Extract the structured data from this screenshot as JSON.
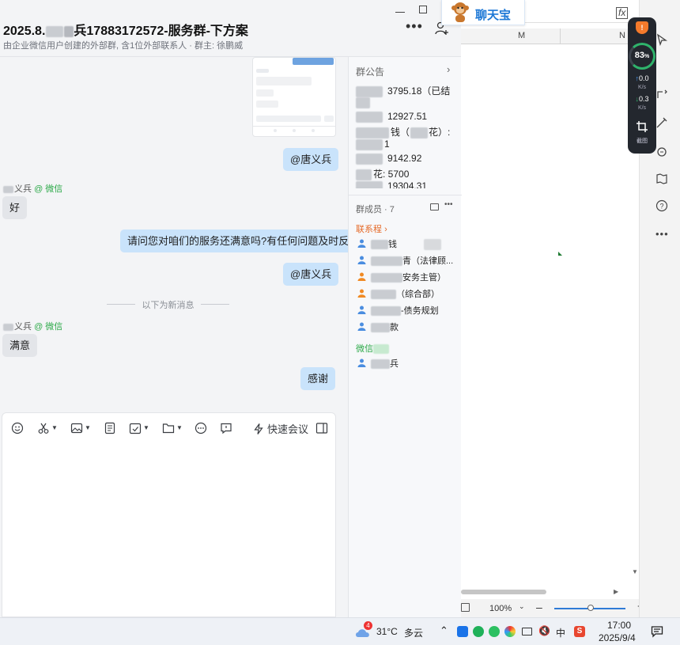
{
  "chat": {
    "title": "2025.8.2███义兵17883172572-服务群-下方案",
    "title_visible": "2025.8.",
    "title_tail": "兵17883172572-服务群-下方案",
    "subtitle": "由企业微信用户创建的外部群, 含1位外部联系人 · 群主: 徐鹏威",
    "more_label": "•••"
  },
  "messages": {
    "mention1": "@唐义兵",
    "sender1": "义兵",
    "sender1_source": "@ 微信",
    "reply1": "好",
    "question": "请问您对咱们的服务还满意吗?有任何问题及时反馈",
    "mention2": "@唐义兵",
    "new_divider": "以下为新消息",
    "sender2": "义兵",
    "sender2_source": "@ 微信",
    "reply2": "满意",
    "thanks": "感谢"
  },
  "composer": {
    "quick_meeting": "快速会议"
  },
  "sidebar": {
    "notice_title": "群公告",
    "notice_lines": [
      "3795.18（已结",
      "12927.51",
      "钱（",
      "花）:",
      "1",
      "9142.92",
      "花: ",
      "5700",
      "19304.31"
    ],
    "members_title": "群成员 · 7",
    "role_label": "联系程",
    "members": [
      {
        "name": "钱",
        "tail": ""
      },
      {
        "name": "青（法律顾..."
      },
      {
        "name": "安务主管）"
      },
      {
        "name": "（综合部）"
      },
      {
        "name": "-债务规划"
      },
      {
        "name": "款"
      }
    ],
    "wechat_label": "微信",
    "wechat_member": "兵"
  },
  "plugin": {
    "label": "聊天宝"
  },
  "excel": {
    "col_m": "M",
    "col_n": "N",
    "zoom": "100%"
  },
  "monitor": {
    "percent": "83",
    "unit": "%",
    "up": "0.0",
    "up_unit": "K/s",
    "down": "0.3",
    "down_unit": "K/s",
    "screenshot": "截图"
  },
  "taskbar": {
    "weather_badge": "4",
    "temp": "31°C",
    "weather": "多云",
    "ime": "中",
    "time": "17:00",
    "date": "2025/9/4"
  },
  "colors": {
    "bubble_right": "#c9e3fb",
    "bubble_left": "#e3e5e9",
    "wechat_green": "#2eaa4a",
    "accent_orange": "#f57a2b"
  }
}
